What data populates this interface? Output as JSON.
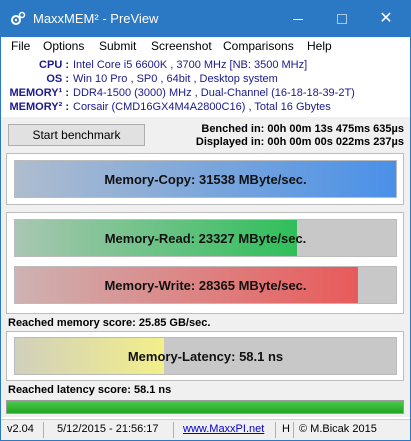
{
  "window": {
    "title": "MaxxMEM² - PreView",
    "colors": {
      "titlebar": "#2b78c4"
    },
    "controls": {
      "minimize_icon": "minimize-icon",
      "maximize_icon": "maximize-icon",
      "close_icon": "close-icon",
      "close_glyph": "✕"
    }
  },
  "menu": [
    "File",
    "Options",
    "Submit",
    "Screenshot",
    "Comparisons",
    "Help"
  ],
  "sysinfo": [
    {
      "label": "CPU :",
      "value": "Intel Core i5 6600K , 3700 MHz  [NB: 3500 MHz]"
    },
    {
      "label": "OS :",
      "value": "Win 10 Pro , SP0 , 64bit , Desktop system"
    },
    {
      "label": "MEMORY¹ :",
      "value": "DDR4-1500 (3000) MHz , Dual-Channel (16-18-18-39-2T)"
    },
    {
      "label": "MEMORY² :",
      "value": "Corsair (CMD16GX4M4A2800C16) , Total 16 Gbytes"
    }
  ],
  "controls": {
    "start_label": "Start benchmark",
    "benched": "Benched in: 00h 00m 13s 475ms 635µs",
    "displayed": "Displayed in: 00h 00m 00s 022ms 237µs"
  },
  "bars": {
    "copy": {
      "label": "Memory-Copy: 31538 MByte/sec.",
      "fraction": 1.0,
      "color": "#4a90e8"
    },
    "read": {
      "label": "Memory-Read: 23327 MByte/sec.",
      "fraction": 0.74,
      "color": "#2fbf5a"
    },
    "write": {
      "label": "Memory-Write: 28365 MByte/sec.",
      "fraction": 0.9,
      "color": "#e95a5a"
    },
    "latency": {
      "label": "Memory-Latency: 58.1 ns",
      "fraction": 0.39,
      "color": "#f3ef8a"
    }
  },
  "scores": {
    "memory": "Reached memory score: 25.85 GB/sec.",
    "latency": "Reached latency score: 58.1 ns"
  },
  "progress": {
    "fraction": 1.0
  },
  "status": {
    "version": "v2.04",
    "date": "5/12/2015 - 21:56:17",
    "link": "www.MaxxPI.net",
    "mode": "H",
    "copyright": "© M.Bicak 2015"
  }
}
